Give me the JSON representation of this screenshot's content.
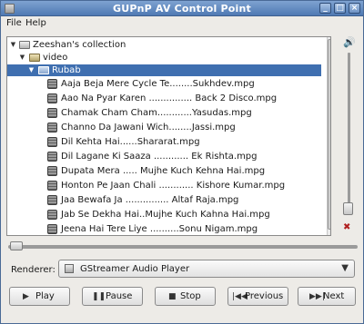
{
  "window": {
    "title": "GUPnP AV Control Point"
  },
  "menu": {
    "file": "File",
    "help": "Help"
  },
  "tree": {
    "root": "Zeeshan's collection",
    "video": "video",
    "selected": "Rubab",
    "items": [
      "Aaja Beja Mere Cycle Te........Sukhdev.mpg",
      "Aao Na Pyar Karen ............... Back 2 Disco.mpg",
      "Chamak Cham Cham............Yasudas.mpg",
      "Channo Da Jawani Wich........Jassi.mpg",
      "Dil Kehta Hai......Shararat.mpg",
      "Dil Lagane Ki Saaza ............ Ek Rishta.mpg",
      "Dupata Mera ..... Mujhe Kuch Kehna Hai.mpg",
      "Honton Pe Jaan Chali ............ Kishore Kumar.mpg",
      "Jaa Bewafa Ja ............... Altaf Raja.mpg",
      "Jab Se Dekha Hai..Mujhe Kuch Kahna Hai.mpg",
      "Jeena Hai Tere Liye ..........Sonu Nigam.mpg"
    ]
  },
  "renderer": {
    "label": "Renderer:",
    "value": "GStreamer Audio Player"
  },
  "buttons": {
    "play": "Play",
    "pause": "Pause",
    "stop": "Stop",
    "previous": "Previous",
    "next": "Next"
  }
}
